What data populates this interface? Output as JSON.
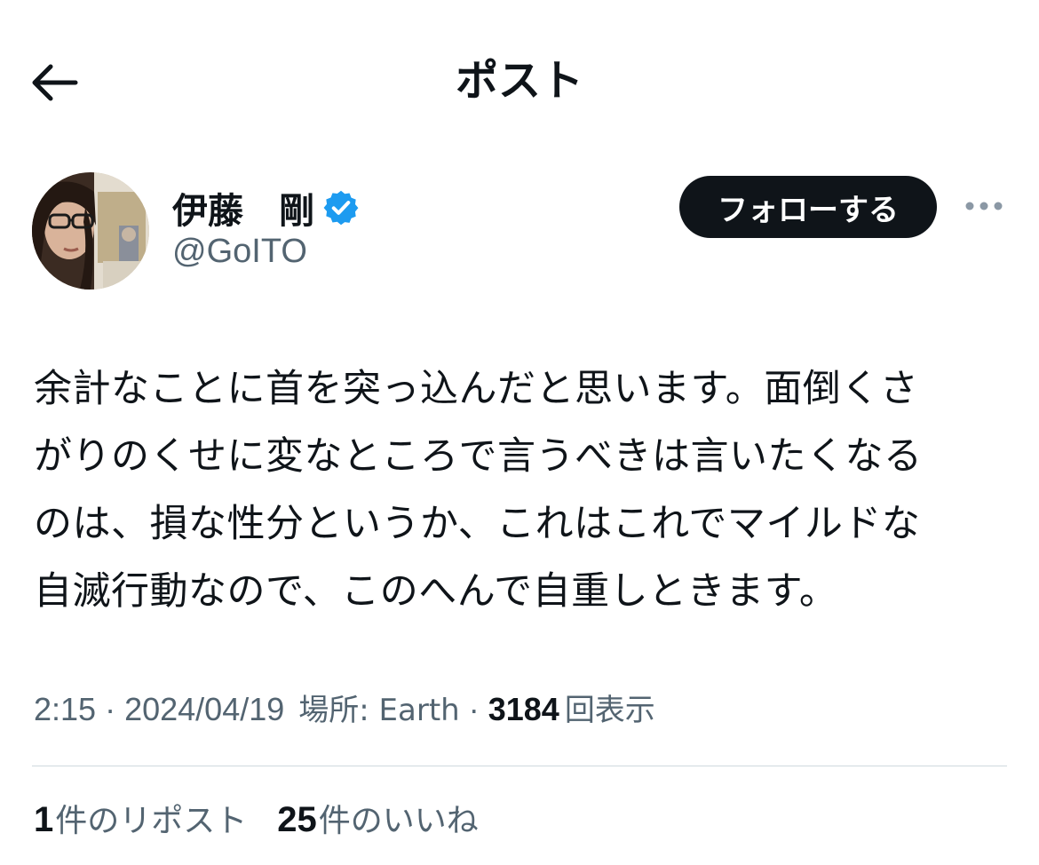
{
  "header": {
    "title": "ポスト",
    "back_icon": "arrow-left-icon"
  },
  "author": {
    "display_name": "伊藤　剛",
    "handle": "@GoITO",
    "verified_icon": "verified-badge-icon",
    "verified_color": "#1d9bf0"
  },
  "actions": {
    "follow_label": "フォローする",
    "more_icon": "more-horizontal-icon"
  },
  "post": {
    "lines": [
      "余計なことに首を突っ込んだと思います。面倒くさ",
      "がりのくせに変なところで言うべきは言いたくなる",
      "のは、損な性分というか、これはこれでマイルドな",
      "自滅行動なので、このへんで自重しときます。"
    ]
  },
  "meta": {
    "time": "2:15",
    "separator": "·",
    "date": "2024/04/19",
    "location": "場所: Earth",
    "views_count": "3184",
    "views_label": "回表示"
  },
  "stats": {
    "reposts_count": "1",
    "reposts_label": "件のリポスト",
    "likes_count": "25",
    "likes_label": "件のいいね"
  },
  "colors": {
    "text": "#0f1419",
    "secondary": "#536471",
    "divider": "#cfd9de",
    "follow_bg": "#0f1419",
    "follow_text": "#ffffff"
  }
}
